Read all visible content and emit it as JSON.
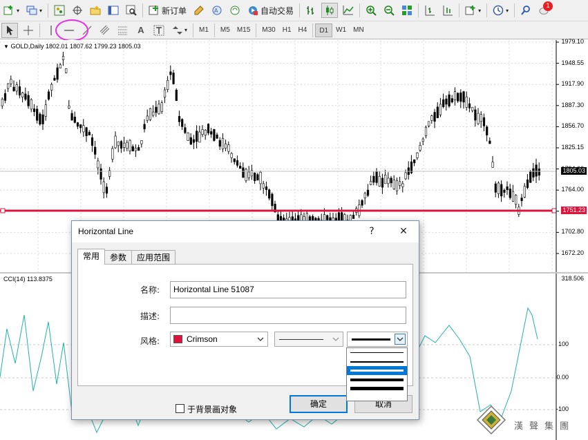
{
  "toolbar_top": {
    "new_order_label": "新订单",
    "auto_trading_label": "自动交易",
    "notification_count": "1"
  },
  "toolbar_tools": {
    "text_tool_label": "A",
    "timeframes": [
      "M1",
      "M5",
      "M15",
      "M30",
      "H1",
      "H4",
      "D1",
      "W1",
      "MN"
    ],
    "active_timeframe": "D1"
  },
  "price_chart": {
    "symbol_info": "GOLD,Daily  1802.01 1807.62 1799.23 1805.03",
    "price_scale": [
      "1979.10",
      "1948.55",
      "1917.90",
      "1887.30",
      "1856.70",
      "1825.15",
      "1794.60",
      "1764.00",
      "1733.45",
      "1702.80",
      "1672.20"
    ],
    "current_price_tag": "1805.03",
    "hline_price_tag": "1751.23",
    "hline_color": "#dc143c"
  },
  "cci_panel": {
    "label": "CCI(14) 113.8375",
    "scale": [
      "318.506",
      "100",
      "0.00",
      "-100"
    ],
    "line_color": "#20b2aa"
  },
  "dialog": {
    "title": "Horizontal Line",
    "help_button": "?",
    "close_button": "✕",
    "tabs": [
      "常用",
      "参数",
      "应用范围"
    ],
    "active_tab": "常用",
    "name_label": "名称:",
    "name_value": "Horizontal Line 51087",
    "description_label": "描述:",
    "description_value": "",
    "style_label": "风格:",
    "color_name": "Crimson",
    "color_hex": "#dc143c",
    "background_checkbox_label": "于背景画对象",
    "background_checked": false,
    "ok_label": "确定",
    "cancel_label": "取消"
  },
  "logo": {
    "text": "漢聲集團"
  }
}
